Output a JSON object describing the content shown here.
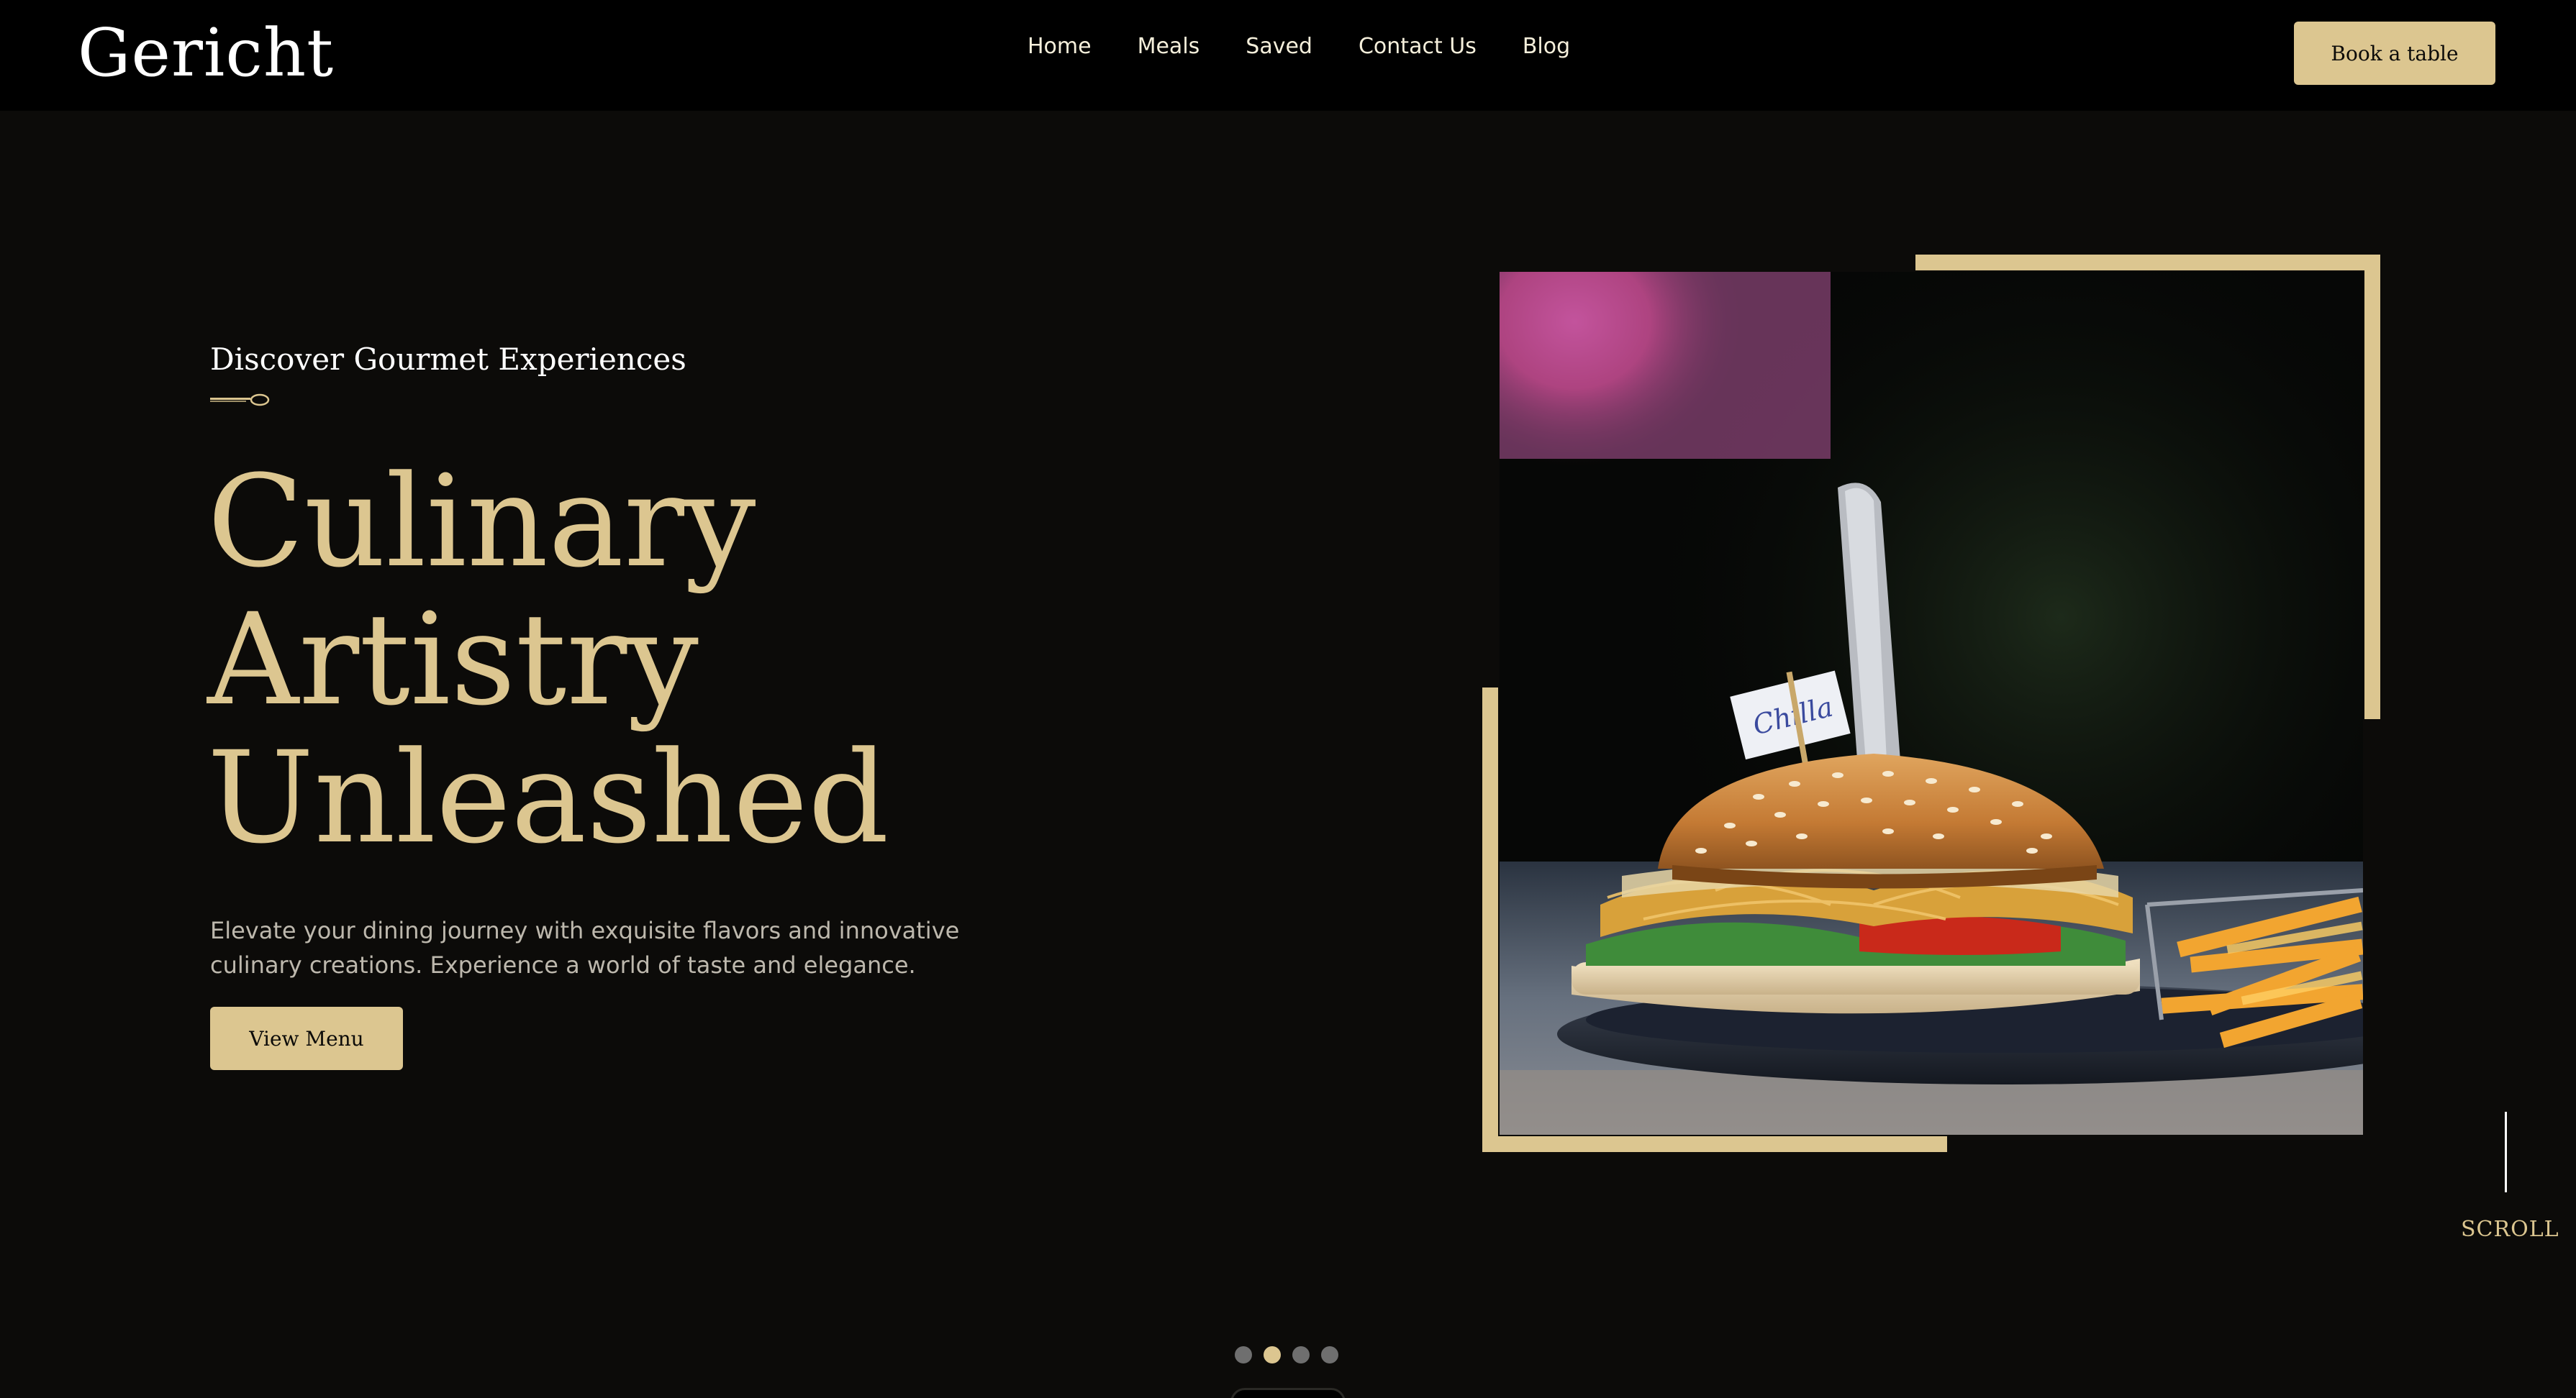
{
  "brand": {
    "logo": "Gericht"
  },
  "nav": {
    "items": [
      {
        "label": "Home"
      },
      {
        "label": "Meals"
      },
      {
        "label": "Saved"
      },
      {
        "label": "Contact Us"
      },
      {
        "label": "Blog"
      }
    ],
    "cta_label": "Book a table"
  },
  "hero": {
    "subtitle": "Discover Gourmet Experiences",
    "headline": [
      "Culinary",
      "Artistry",
      "Unleashed"
    ],
    "description": "Elevate your dining journey with exquisite flavors and innovative culinary creations. Experience a world of taste and elegance.",
    "button_label": "View Menu",
    "image_name": "burger-photo",
    "image_flag_text": "Chilla"
  },
  "scroll": {
    "label": "SCROLL"
  },
  "carousel": {
    "dot_count": 4,
    "active_index": 1
  },
  "colors": {
    "accent": "#dcc690",
    "background": "#0c0b09",
    "navbar": "#000000",
    "text_light": "#ffffff",
    "text_muted": "#bdb8ad"
  }
}
